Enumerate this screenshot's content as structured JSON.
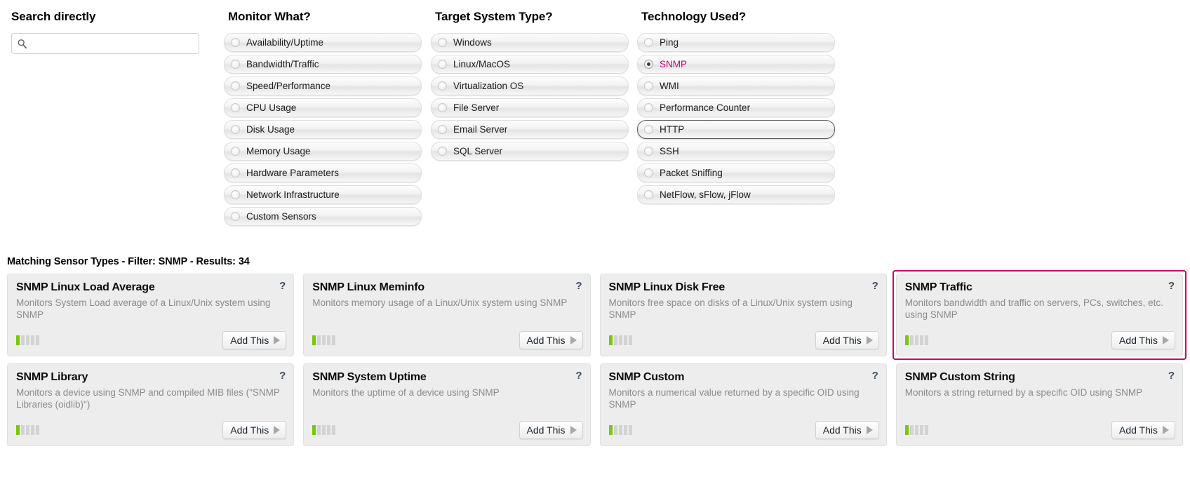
{
  "columns": {
    "search": {
      "title": "Search directly",
      "placeholder": "",
      "value": "",
      "icon": "search-icon"
    },
    "monitor": {
      "title": "Monitor What?",
      "options": [
        {
          "label": "Availability/Uptime",
          "selected": false,
          "focused": false
        },
        {
          "label": "Bandwidth/Traffic",
          "selected": false,
          "focused": false
        },
        {
          "label": "Speed/Performance",
          "selected": false,
          "focused": false
        },
        {
          "label": "CPU Usage",
          "selected": false,
          "focused": false
        },
        {
          "label": "Disk Usage",
          "selected": false,
          "focused": false
        },
        {
          "label": "Memory Usage",
          "selected": false,
          "focused": false
        },
        {
          "label": "Hardware Parameters",
          "selected": false,
          "focused": false
        },
        {
          "label": "Network Infrastructure",
          "selected": false,
          "focused": false
        },
        {
          "label": "Custom Sensors",
          "selected": false,
          "focused": false
        }
      ]
    },
    "target": {
      "title": "Target System Type?",
      "options": [
        {
          "label": "Windows",
          "selected": false,
          "focused": false
        },
        {
          "label": "Linux/MacOS",
          "selected": false,
          "focused": false
        },
        {
          "label": "Virtualization OS",
          "selected": false,
          "focused": false
        },
        {
          "label": "File Server",
          "selected": false,
          "focused": false
        },
        {
          "label": "Email Server",
          "selected": false,
          "focused": false
        },
        {
          "label": "SQL Server",
          "selected": false,
          "focused": false
        }
      ]
    },
    "technology": {
      "title": "Technology Used?",
      "options": [
        {
          "label": "Ping",
          "selected": false,
          "focused": false
        },
        {
          "label": "SNMP",
          "selected": true,
          "focused": false
        },
        {
          "label": "WMI",
          "selected": false,
          "focused": false
        },
        {
          "label": "Performance Counter",
          "selected": false,
          "focused": false
        },
        {
          "label": "HTTP",
          "selected": false,
          "focused": true
        },
        {
          "label": "SSH",
          "selected": false,
          "focused": false
        },
        {
          "label": "Packet Sniffing",
          "selected": false,
          "focused": false
        },
        {
          "label": "NetFlow, sFlow, jFlow",
          "selected": false,
          "focused": false
        }
      ]
    }
  },
  "results": {
    "heading": "Matching Sensor Types - Filter: SNMP - Results: 34",
    "filter": "SNMP",
    "count": "34",
    "help_glyph": "?",
    "add_label": "Add This",
    "rating_total": 5,
    "cards": [
      {
        "title": "SNMP Linux Load Average",
        "description": "Monitors System Load average of a Linux/Unix system using SNMP",
        "rating": 1,
        "highlighted": false
      },
      {
        "title": "SNMP Linux Meminfo",
        "description": "Monitors memory usage of a Linux/Unix system using SNMP",
        "rating": 1,
        "highlighted": false
      },
      {
        "title": "SNMP Linux Disk Free",
        "description": "Monitors free space on disks of a Linux/Unix system using SNMP",
        "rating": 1,
        "highlighted": false
      },
      {
        "title": "SNMP Traffic",
        "description": "Monitors bandwidth and traffic on servers, PCs, switches, etc. using SNMP",
        "rating": 1,
        "highlighted": true
      },
      {
        "title": "SNMP Library",
        "description": "Monitors a device using SNMP and compiled MIB files (\"SNMP Libraries (oidlib)\")",
        "rating": 1,
        "highlighted": false
      },
      {
        "title": "SNMP System Uptime",
        "description": "Monitors the uptime of a device using SNMP",
        "rating": 1,
        "highlighted": false
      },
      {
        "title": "SNMP Custom",
        "description": "Monitors a numerical value returned by a specific OID using SNMP",
        "rating": 1,
        "highlighted": false
      },
      {
        "title": "SNMP Custom String",
        "description": "Monitors a string returned by a specific OID using SNMP",
        "rating": 1,
        "highlighted": false
      }
    ]
  },
  "colors": {
    "accent": "#cc006d",
    "highlight_border": "#c4006e",
    "rating_on": "#7ac70c",
    "rating_off": "#d3d3d3",
    "card_bg": "#ededed",
    "desc_text": "#8b8b8b"
  }
}
